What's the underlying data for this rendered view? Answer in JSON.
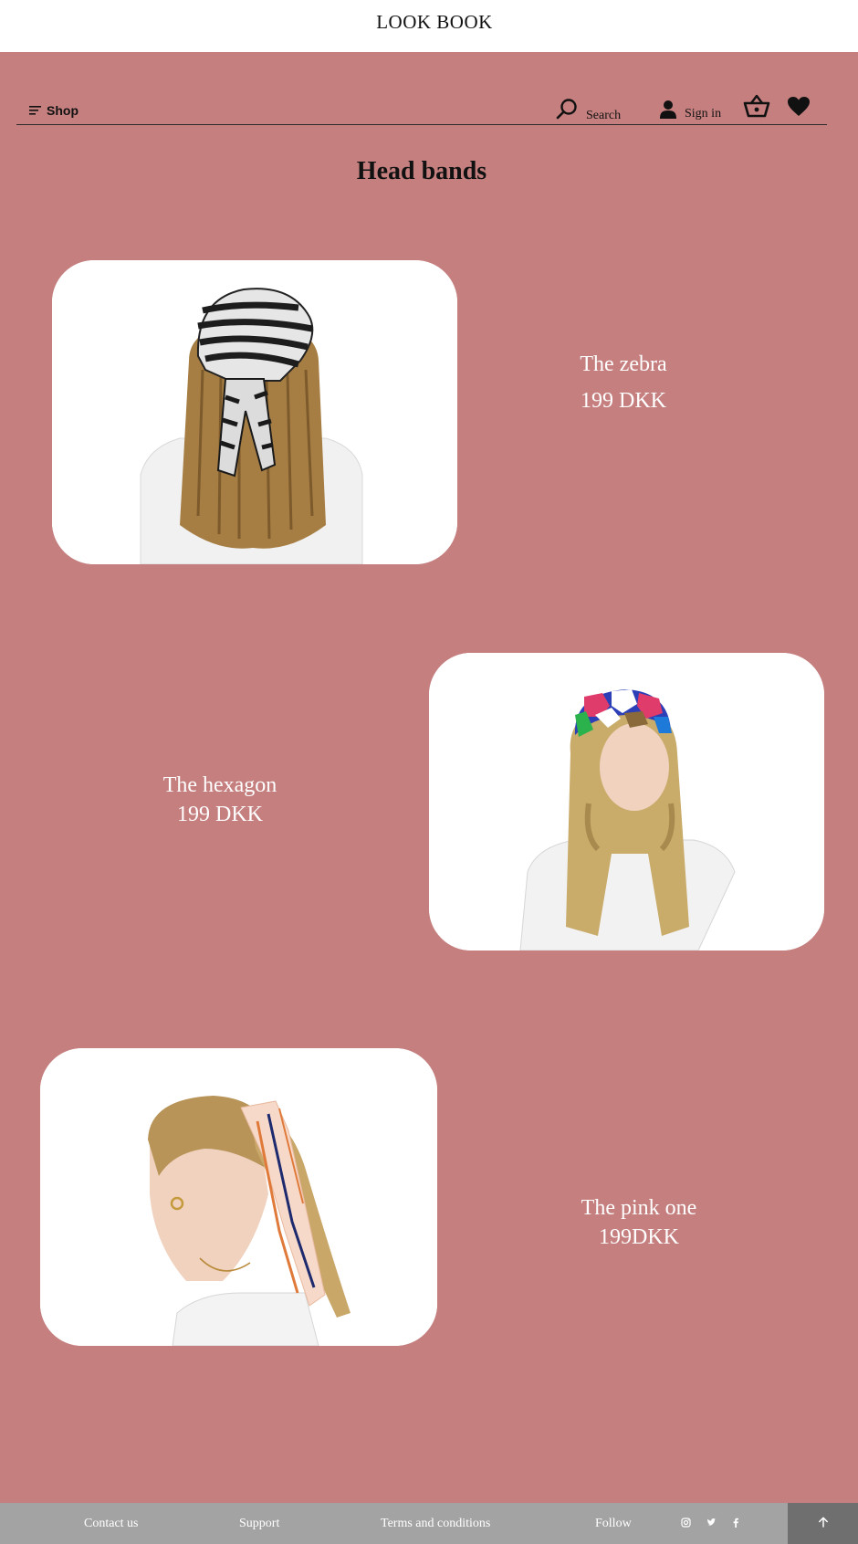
{
  "brand": "LOOK BOOK",
  "nav": {
    "shop_label": "Shop",
    "search_label": "Search",
    "signin_label": "Sign in"
  },
  "page_title": "Head bands",
  "products": [
    {
      "name": "The zebra",
      "price": "199 DKK"
    },
    {
      "name": "The hexagon",
      "price": "199 DKK"
    },
    {
      "name": "The pink one",
      "price": "199DKK"
    }
  ],
  "footer": {
    "contact": "Contact us",
    "support": "Support",
    "terms": "Terms and conditions",
    "follow": "Follow"
  },
  "icons": {
    "menu": "menu-icon",
    "search": "search-icon",
    "user": "user-icon",
    "basket": "basket-icon",
    "heart": "heart-icon",
    "instagram": "instagram-icon",
    "twitter": "twitter-icon",
    "facebook": "facebook-icon",
    "arrow_up": "arrow-up-icon"
  },
  "colors": {
    "main_background": "#c57f7f",
    "footer_background": "#a3a3a3",
    "back_to_top_background": "#6f6f6f",
    "text_light": "#ffffff",
    "text_dark": "#111111"
  }
}
